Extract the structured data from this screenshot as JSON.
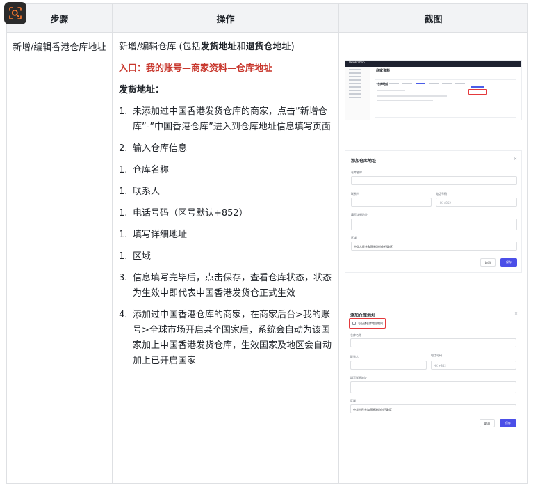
{
  "table": {
    "headers": [
      "步骤",
      "操作",
      "截图"
    ],
    "step": "新增/编辑香港仓库地址",
    "op": {
      "title_prefix": "新增/编辑仓库 (包括",
      "title_bold1": "发货地址",
      "title_mid": "和",
      "title_bold2": "退货仓地址",
      "title_suffix": ")",
      "entry": "入口：我的账号—商家资料—仓库地址",
      "section": "发货地址：",
      "items": [
        {
          "num": "1.",
          "text": "未添加过中国香港发货仓库的商家，点击”新增仓库”-”中国香港仓库”进入到仓库地址信息填写页面"
        },
        {
          "num": "2.",
          "text": "输入仓库信息"
        },
        {
          "num": "1.",
          "text": "仓库名称"
        },
        {
          "num": "1.",
          "text": "联系人"
        },
        {
          "num": "1.",
          "text": "电话号码（区号默认+852）"
        },
        {
          "num": "1.",
          "text": "填写详细地址"
        },
        {
          "num": "1.",
          "text": "区域"
        },
        {
          "num": "3.",
          "text": "信息填写完毕后，点击保存，查看仓库状态，状态为生效中即代表中国香港发货仓正式生效"
        },
        {
          "num": "4.",
          "text": "添加过中国香港仓库的商家，在商家后台>我的账号>全球市场开启某个国家后，系统会自动为该国家加上中国香港发货仓库，生效国家及地区会自动加上已开启国家"
        }
      ]
    }
  },
  "screens": {
    "s1": {
      "logo": "TikTok Shop",
      "page_title": "商家资料",
      "card_title": "仓库地址"
    },
    "s2": {
      "title": "添加仓库地址",
      "close": "×",
      "warehouse_name": "仓库名称",
      "contact": "联系人",
      "phone": "电话号码",
      "address": "填写详细地址",
      "region": "区域",
      "phone_prefix": "HK +852",
      "region_value": "中华人民共和国香港特别行政区",
      "cancel": "取消",
      "save": "保存"
    },
    "s3": {
      "title": "添加仓库地址",
      "close": "×",
      "checkbox": "与上述仓库地址相同",
      "warehouse_name": "仓库名称",
      "contact": "联系人",
      "phone": "电话号码",
      "address": "填写详细地址",
      "region": "区域",
      "phone_prefix": "HK +852",
      "region_value": "中华人民共和国香港特别行政区",
      "cancel": "取消",
      "save": "保存"
    }
  },
  "colors": {
    "accent_red": "#c8372d",
    "primary": "#4b4fe8",
    "border": "#dee0e3",
    "header_bg": "#f2f3f5"
  }
}
